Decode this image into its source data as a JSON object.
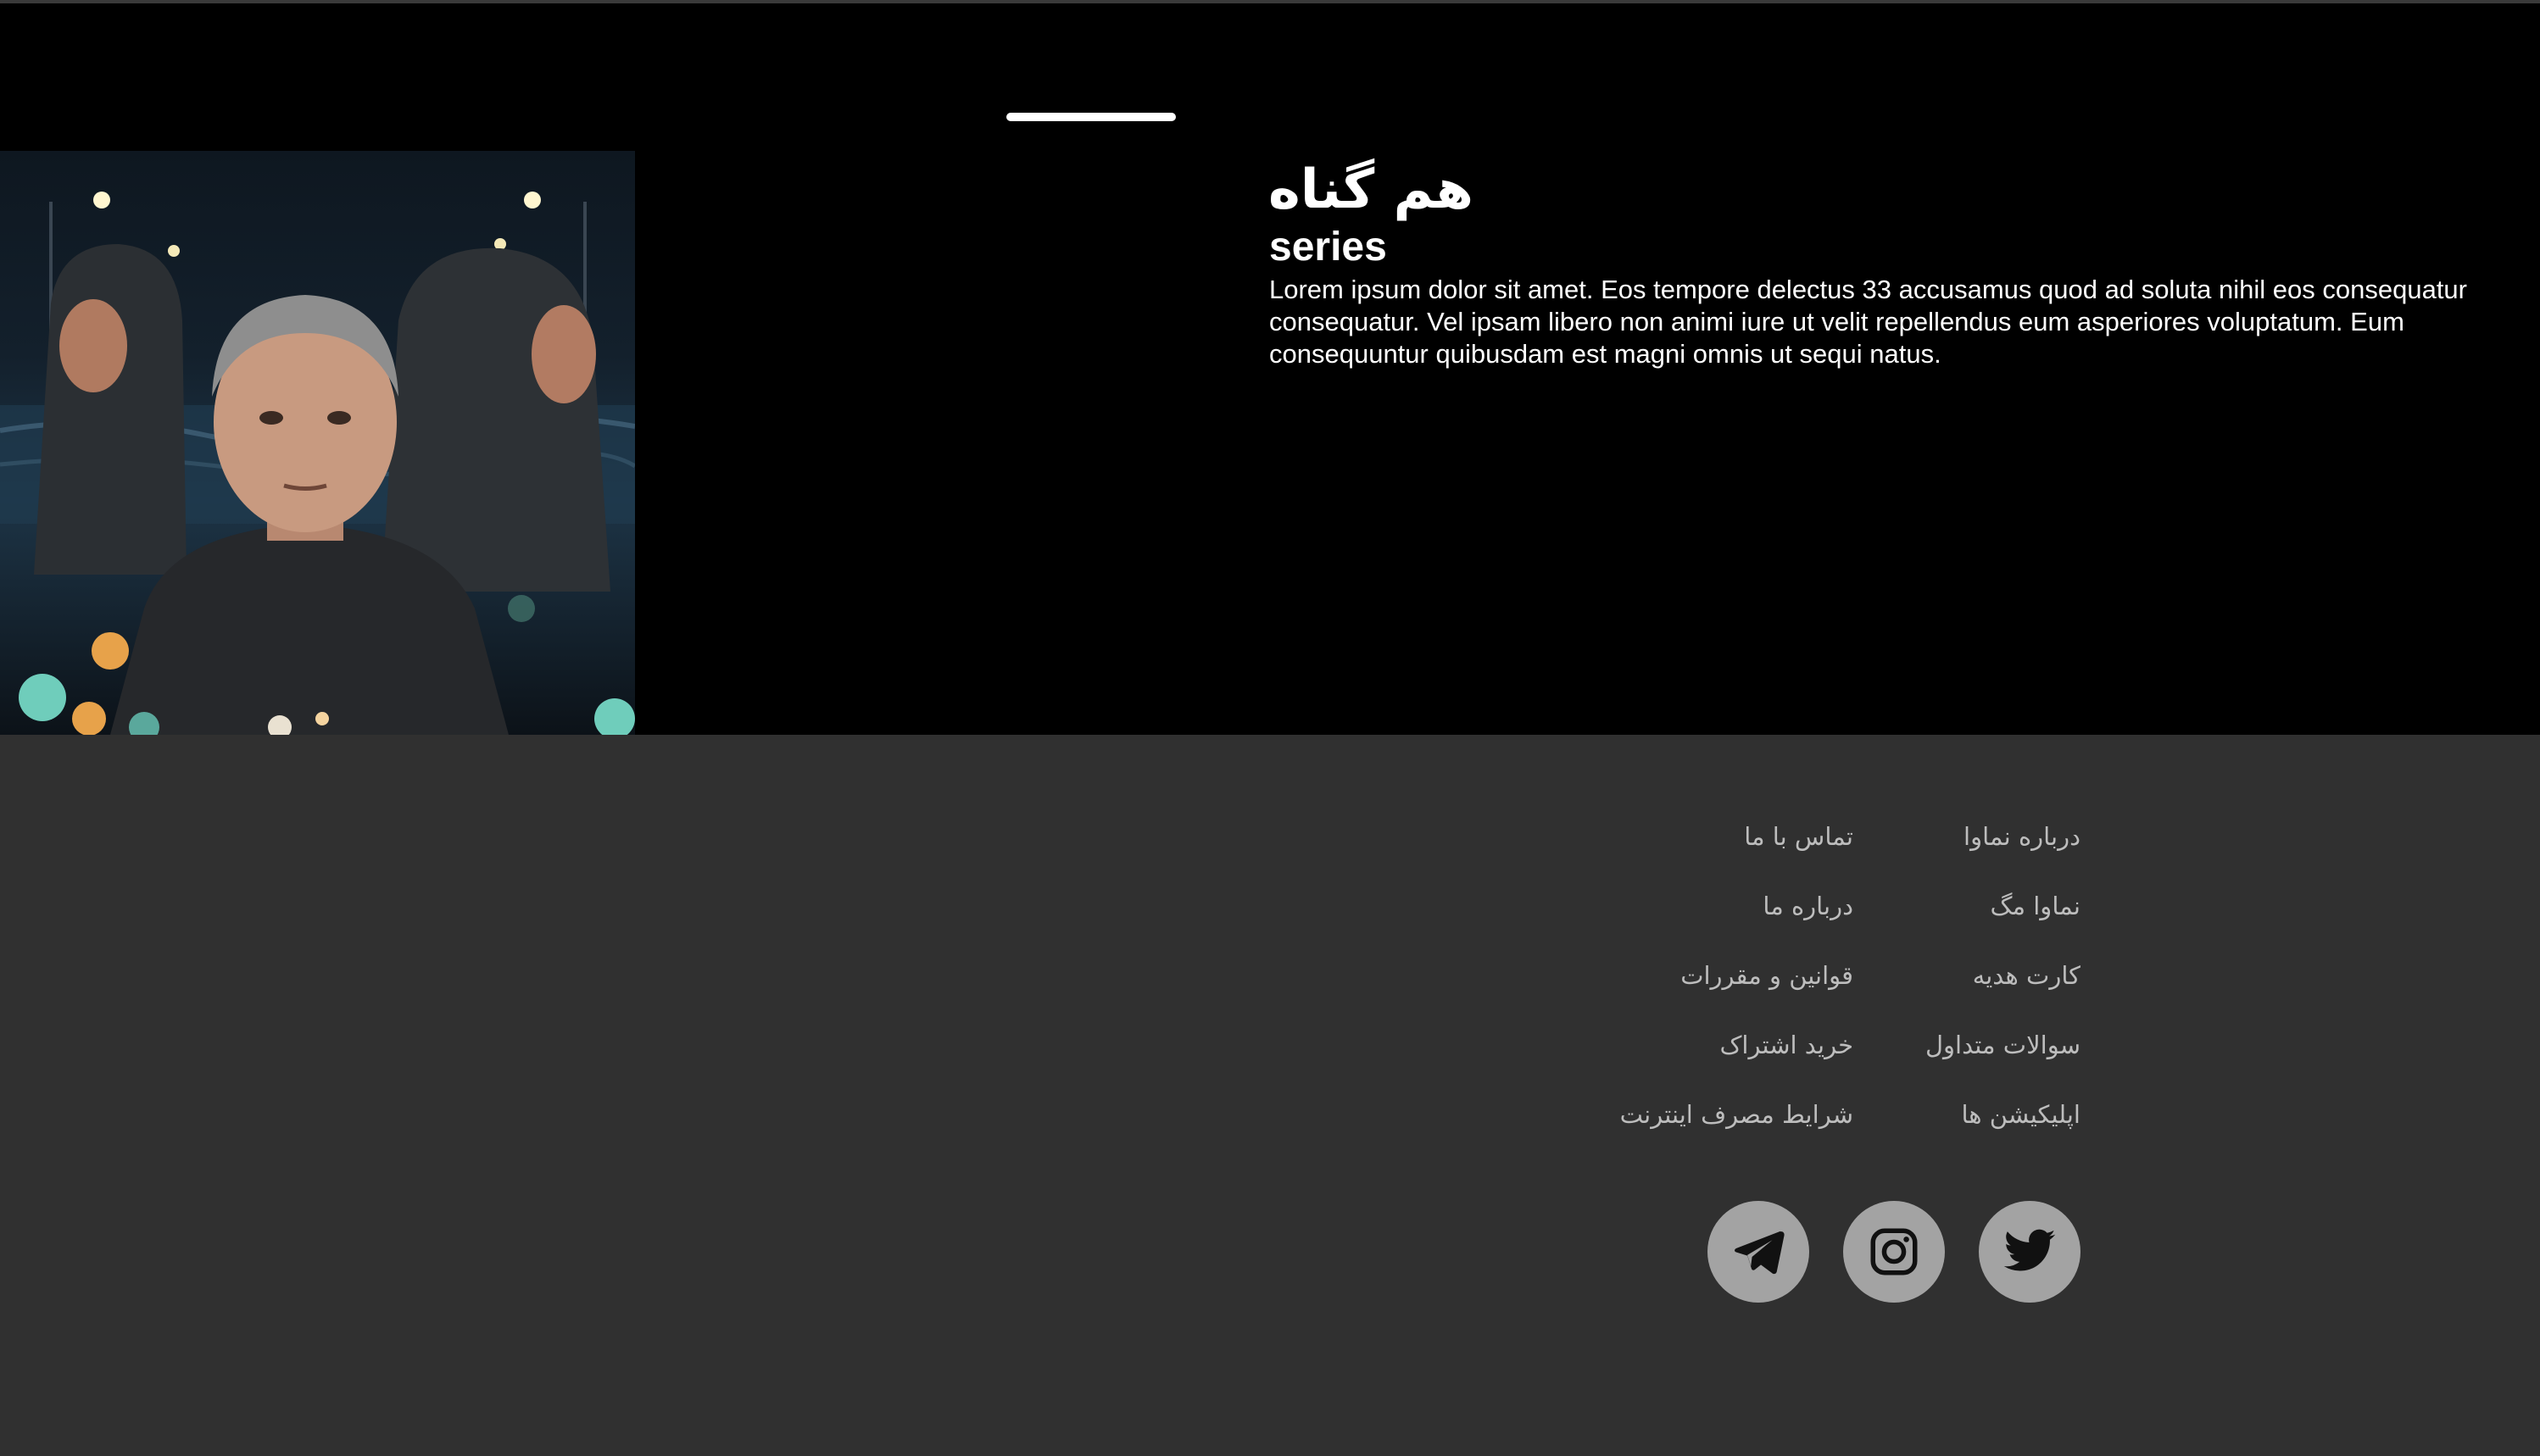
{
  "hero": {
    "title": "هم گناه",
    "type_label": "series",
    "description": "Lorem ipsum dolor sit amet. Eos tempore delectus 33 accusamus quod ad soluta nihil eos consequatur consequatur. Vel ipsam libero non animi iure ut velit repellendus eum asperiores voluptatum. Eum consequuntur quibusdam est magni omnis ut sequi natus."
  },
  "footer": {
    "links_right": [
      "درباره نماوا",
      "نماوا مگ",
      "کارت هدیه",
      "سوالات متداول",
      "اپلیکیشن ها"
    ],
    "links_left": [
      "تماس با ما",
      "درباره ما",
      "قوانین و مقررات",
      "خرید اشتراک",
      "شرایط مصرف اینترنت"
    ],
    "social": [
      "twitter-icon",
      "instagram-icon",
      "telegram-icon"
    ]
  },
  "colors": {
    "hero_bg": "#000000",
    "footer_bg": "#303030",
    "footer_link": "#bdbdbd",
    "social_bg": "#a3a3a3"
  }
}
